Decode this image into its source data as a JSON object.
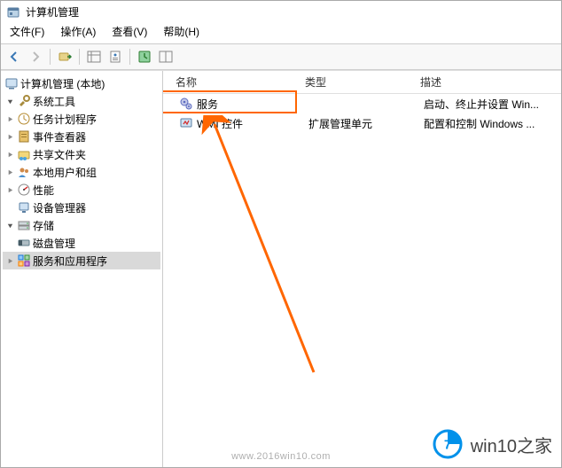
{
  "window": {
    "title": "计算机管理"
  },
  "menus": {
    "file": "文件(F)",
    "action": "操作(A)",
    "view": "查看(V)",
    "help": "帮助(H)"
  },
  "tree": {
    "root": "计算机管理 (本地)",
    "system_tools": "系统工具",
    "task_scheduler": "任务计划程序",
    "event_viewer": "事件查看器",
    "shared_folders": "共享文件夹",
    "local_users": "本地用户和组",
    "performance": "性能",
    "device_manager": "设备管理器",
    "storage": "存储",
    "disk_management": "磁盘管理",
    "services_apps": "服务和应用程序"
  },
  "columns": {
    "name": "名称",
    "type": "类型",
    "desc": "描述"
  },
  "rows": {
    "services": {
      "name": "服务",
      "type": "",
      "desc": "启动、终止并设置 Win..."
    },
    "wmi": {
      "name": "WMI 控件",
      "type": "扩展管理单元",
      "desc": "配置和控制 Windows ..."
    }
  },
  "brand": {
    "text": "win10之家"
  },
  "watermark": "www.2016win10.com"
}
